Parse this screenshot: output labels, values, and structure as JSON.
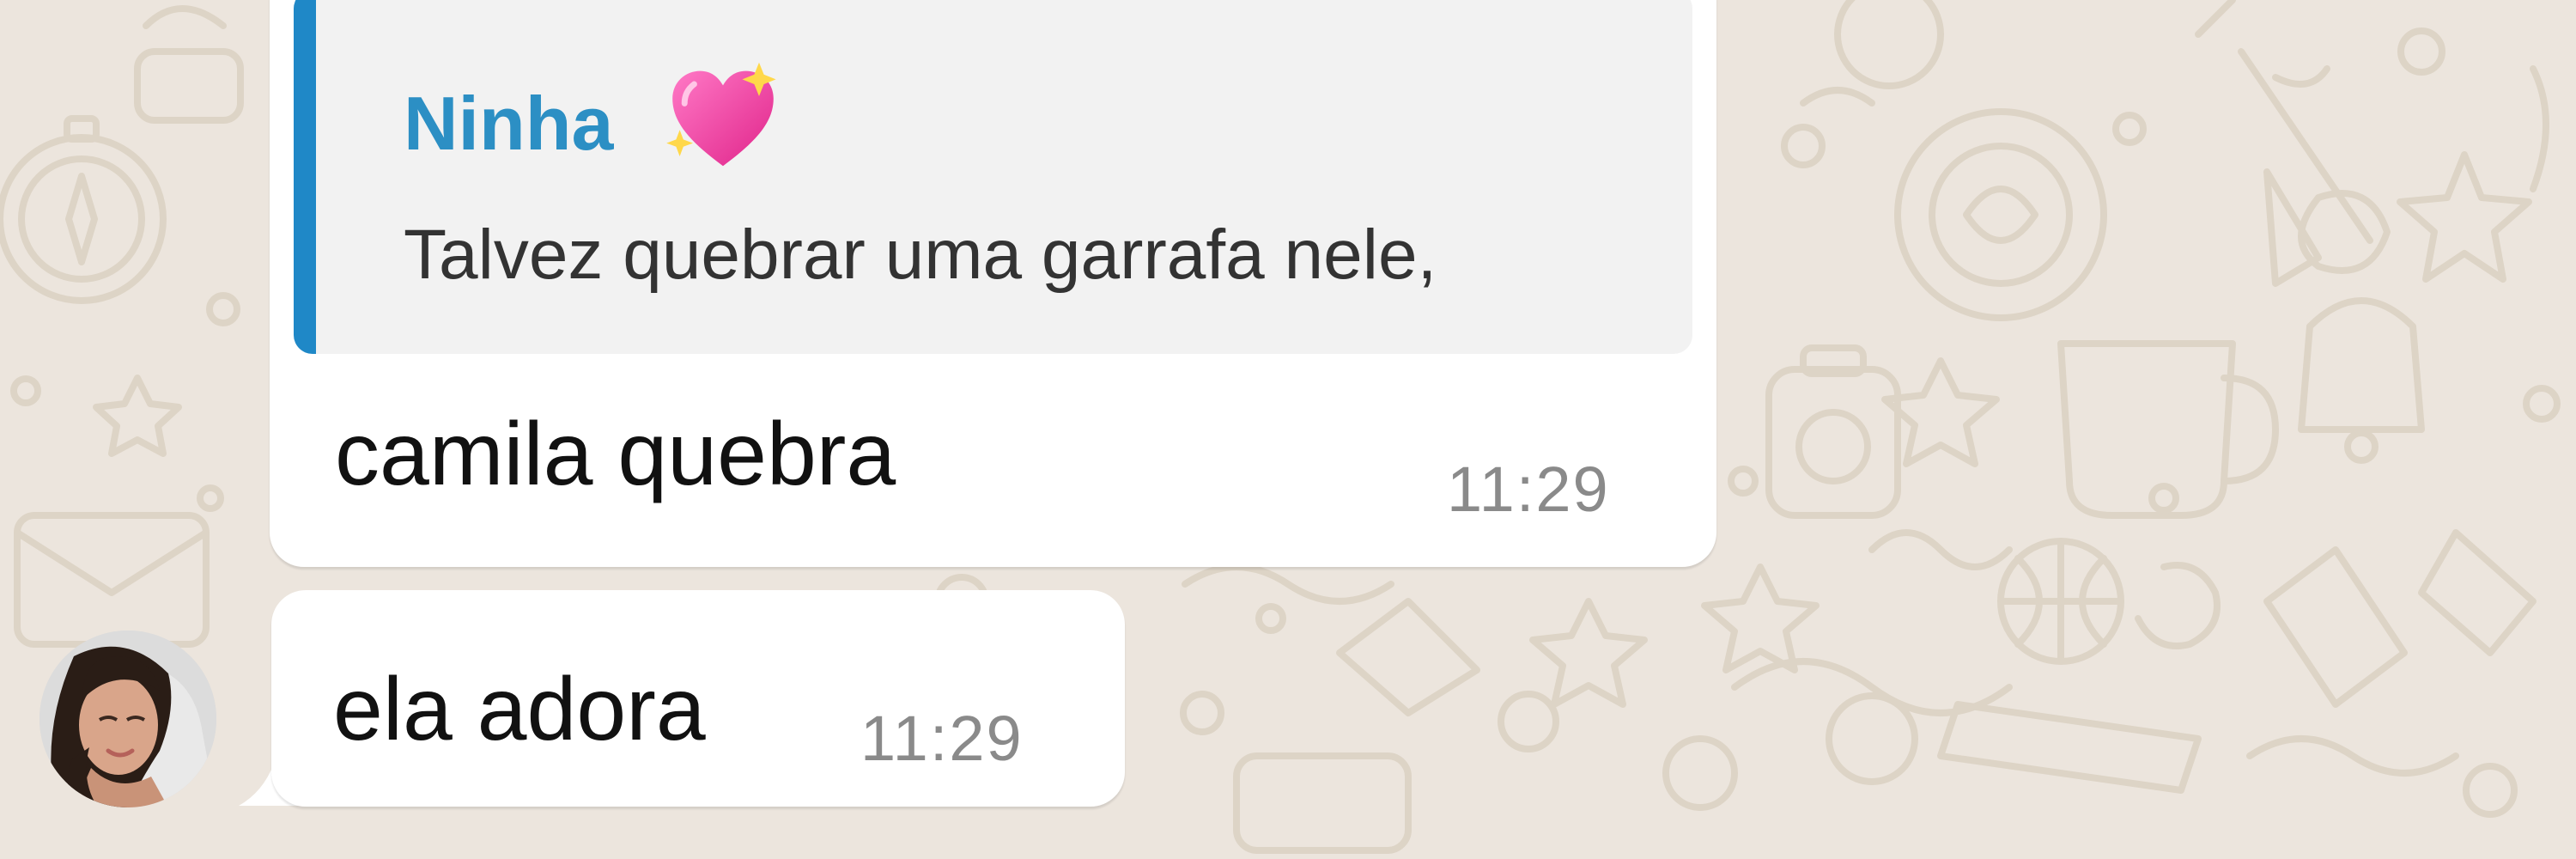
{
  "quoted_message": {
    "sender": "Ninha",
    "sender_emoji": "sparkling-heart-icon",
    "text": "Talvez quebrar uma garrafa nele,"
  },
  "messages": [
    {
      "text": "camila quebra",
      "time": "11:29"
    },
    {
      "text": "ela adora",
      "time": "11:29"
    }
  ],
  "colors": {
    "wallpaper": "#ece5dd",
    "bubble": "#ffffff",
    "quote_background": "#f2f2f2",
    "quote_bar": "#1f88c7",
    "sender_name": "#2c8fc4",
    "timestamp": "#8a8a8a"
  }
}
